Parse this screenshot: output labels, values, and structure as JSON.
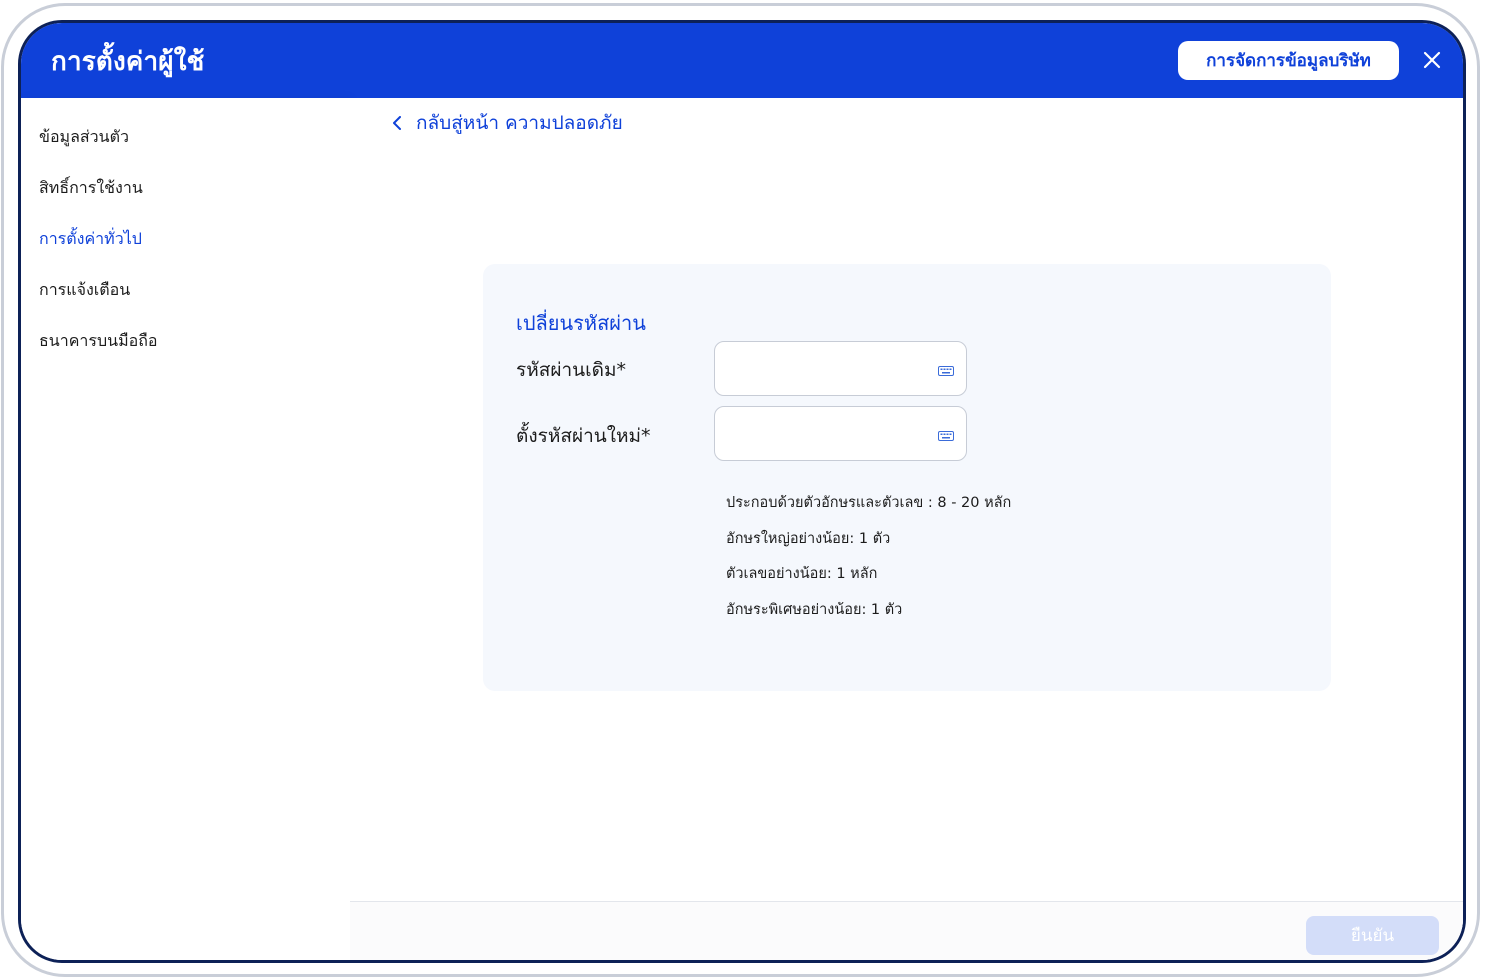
{
  "header": {
    "title": "การตั้งค่าผู้ใช้",
    "company_button": "การจัดการข้อมูลบริษัท"
  },
  "sidebar": {
    "items": [
      {
        "label": "ข้อมูลส่วนตัว",
        "active": false
      },
      {
        "label": "สิทธิ์การใช้งาน",
        "active": false
      },
      {
        "label": "การตั้งค่าทั่วไป",
        "active": true
      },
      {
        "label": "การแจ้งเตือน",
        "active": false
      },
      {
        "label": "ธนาคารบนมือถือ",
        "active": false
      }
    ]
  },
  "breadcrumb": {
    "back_label": "กลับสู่หน้า ความปลอดภัย"
  },
  "form": {
    "title": "เปลี่ยนรหัสผ่าน",
    "old_password_label": "รหัสผ่านเดิม*",
    "old_password_value": "",
    "new_password_label": "ตั้งรหัสผ่านใหม่*",
    "new_password_value": "",
    "rules": [
      "ประกอบด้วยตัวอักษรและตัวเลข : 8 - 20 หลัก",
      "อักษรใหญ่อย่างน้อย: 1 ตัว",
      "ตัวเลขอย่างน้อย: 1 หลัก",
      "อักษระพิเศษอย่างน้อย: 1 ตัว"
    ]
  },
  "footer": {
    "confirm_label": "ยืนยัน"
  },
  "colors": {
    "primary": "#0f41d9",
    "frame_dark": "#0d2157",
    "card_bg": "#f5f8fd",
    "confirm_disabled": "#d3ddf9"
  }
}
